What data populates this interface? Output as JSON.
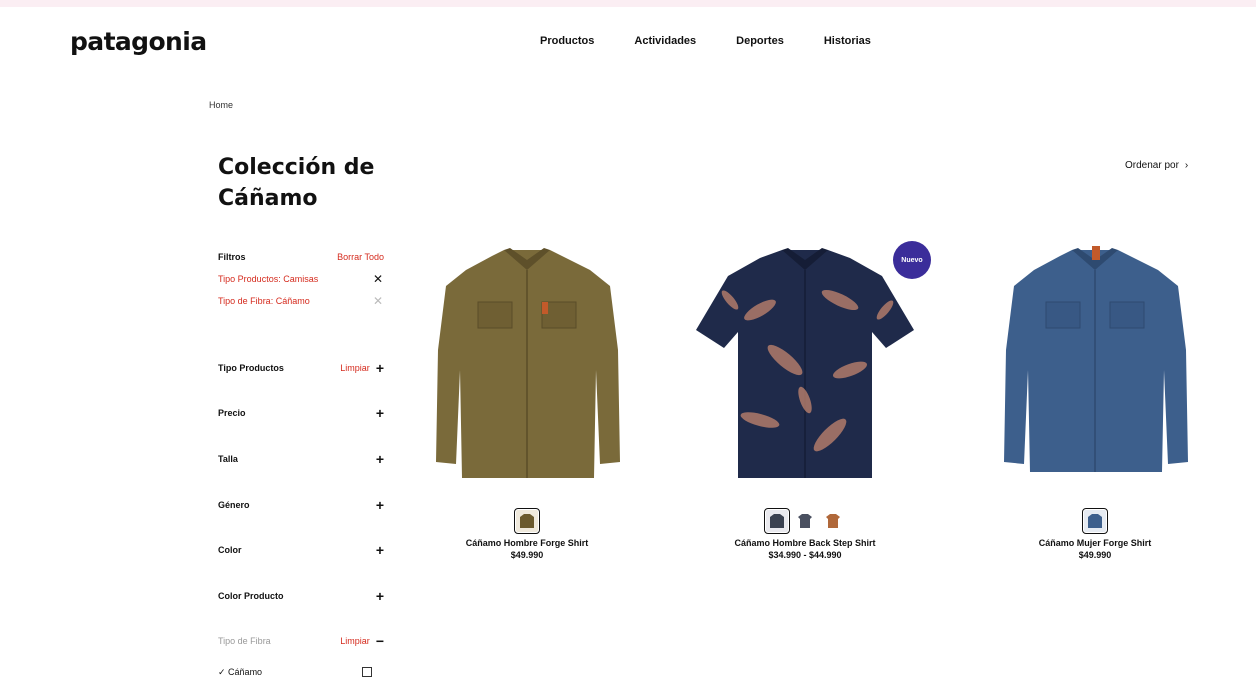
{
  "header": {
    "logo": "patagonia",
    "nav": [
      "Productos",
      "Actividades",
      "Deportes",
      "Historias"
    ]
  },
  "breadcrumb": "Home",
  "page_title": "Colección de Cáñamo",
  "sort": {
    "label": "Ordenar por",
    "icon": "chevron-right-icon"
  },
  "filters": {
    "heading": "Filtros",
    "clear_all": "Borrar Todo",
    "active": [
      {
        "label": "Tipo Productos: Camisas"
      },
      {
        "label": "Tipo de Fibra: Cáñamo"
      }
    ],
    "groups": [
      {
        "label": "Tipo Productos",
        "applied": "Limpiar"
      },
      {
        "label": "Precio",
        "applied": ""
      },
      {
        "label": "Talla",
        "applied": ""
      },
      {
        "label": "Género",
        "applied": ""
      },
      {
        "label": "Color",
        "applied": ""
      },
      {
        "label": "Color Producto",
        "applied": ""
      },
      {
        "label": "Tipo de Fibra",
        "applied": "Limpiar"
      }
    ],
    "checkbox_option": "Cáñamo"
  },
  "products": [
    {
      "name": "Cáñamo Hombre Forge Shirt",
      "price": "$49.990",
      "swatches": [
        "#6b5a2e"
      ],
      "badge": ""
    },
    {
      "name": "Cáñamo Hombre Back Step Shirt",
      "price": "$34.990 - $44.990",
      "swatches": [
        "#3a4150",
        "#4a5060",
        "#b0683a"
      ],
      "badge": "Nuevo"
    },
    {
      "name": "Cáñamo Mujer Forge Shirt",
      "price": "$49.990",
      "swatches": [
        "#3d5f8c"
      ]
    }
  ],
  "colors": {
    "accent_red": "#d52b1e",
    "badge_purple": "#3b2d9a",
    "shirt_olive": "#7a6a3a",
    "shirt_navy": "#1f2a4a",
    "shirt_blue": "#3d5f8c"
  }
}
